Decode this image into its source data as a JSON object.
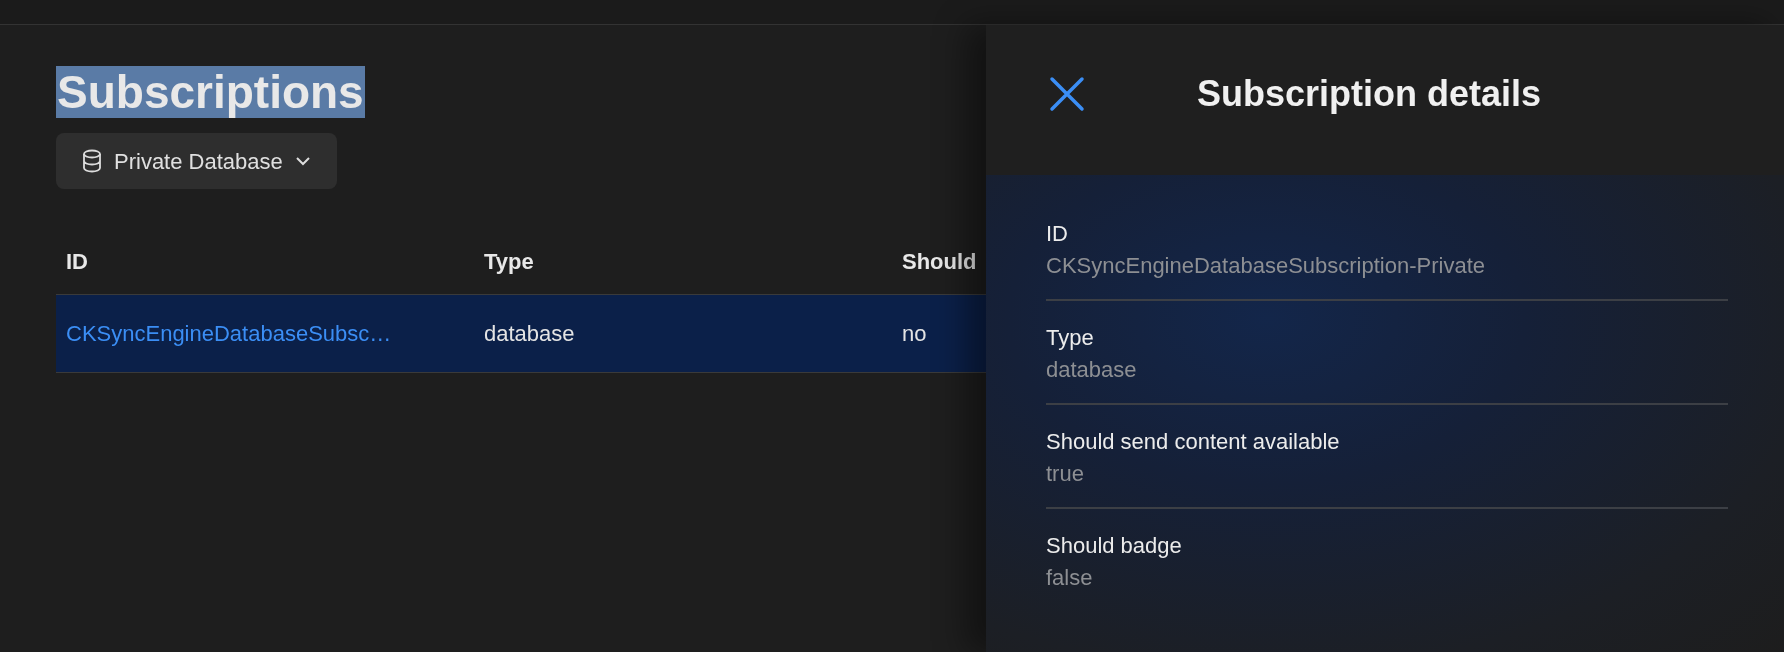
{
  "page": {
    "title": "Subscriptions",
    "title_text_selected": true
  },
  "database_picker": {
    "label": "Private Database"
  },
  "table": {
    "columns": [
      "ID",
      "Type",
      "Should"
    ],
    "rows": [
      {
        "cells": [
          "CKSyncEngineDatabaseSubsc…",
          "database",
          "no"
        ],
        "selected": true
      }
    ]
  },
  "details_panel": {
    "title": "Subscription details",
    "fields": [
      {
        "label": "ID",
        "value": "CKSyncEngineDatabaseSubscription-Private"
      },
      {
        "label": "Type",
        "value": "database"
      },
      {
        "label": "Should send content available",
        "value": "true"
      },
      {
        "label": "Should badge",
        "value": "false"
      }
    ]
  }
}
